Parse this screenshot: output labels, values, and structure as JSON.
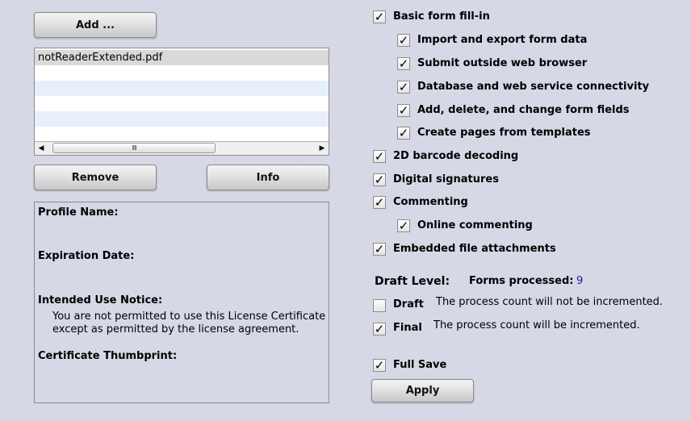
{
  "buttons": {
    "add": "Add ...",
    "remove": "Remove",
    "info": "Info",
    "apply": "Apply"
  },
  "list": {
    "items": [
      "notReaderExtended.pdf"
    ]
  },
  "info_panel": {
    "profile_name_label": "Profile Name:",
    "expiration_date_label": "Expiration Date:",
    "intended_use_label": "Intended Use Notice:",
    "intended_use_line1": "You are not permitted to use this License Certificate",
    "intended_use_line2": "except as permitted by the license agreement.",
    "thumbprint_label": "Certificate Thumbprint:"
  },
  "rights": [
    {
      "label": "Basic form fill-in",
      "checked": true
    },
    {
      "label": "Import and export form data",
      "checked": true
    },
    {
      "label": "Submit outside web browser",
      "checked": true
    },
    {
      "label": "Database and web service connectivity",
      "checked": true
    },
    {
      "label": "Add, delete, and change form fields",
      "checked": true
    },
    {
      "label": "Create pages from templates",
      "checked": true
    },
    {
      "label": "2D barcode decoding",
      "checked": true
    },
    {
      "label": "Digital signatures",
      "checked": true
    },
    {
      "label": "Commenting",
      "checked": true
    },
    {
      "label": "Online commenting",
      "checked": true
    },
    {
      "label": "Embedded file attachments",
      "checked": true
    }
  ],
  "draft": {
    "title": "Draft Level:",
    "forms_processed_label": "Forms processed:",
    "forms_processed_value": "9",
    "draft_option": {
      "label": "Draft",
      "checked": false,
      "description": "The process count will not be incremented."
    },
    "final_option": {
      "label": "Final",
      "checked": true,
      "description": "The process count will be incremented."
    }
  },
  "full_save": {
    "label": "Full Save",
    "checked": true
  },
  "colors": {
    "background": "#d6d8e6",
    "count_value": "#1a1aa6",
    "list_alt_row": "#e8effc"
  }
}
